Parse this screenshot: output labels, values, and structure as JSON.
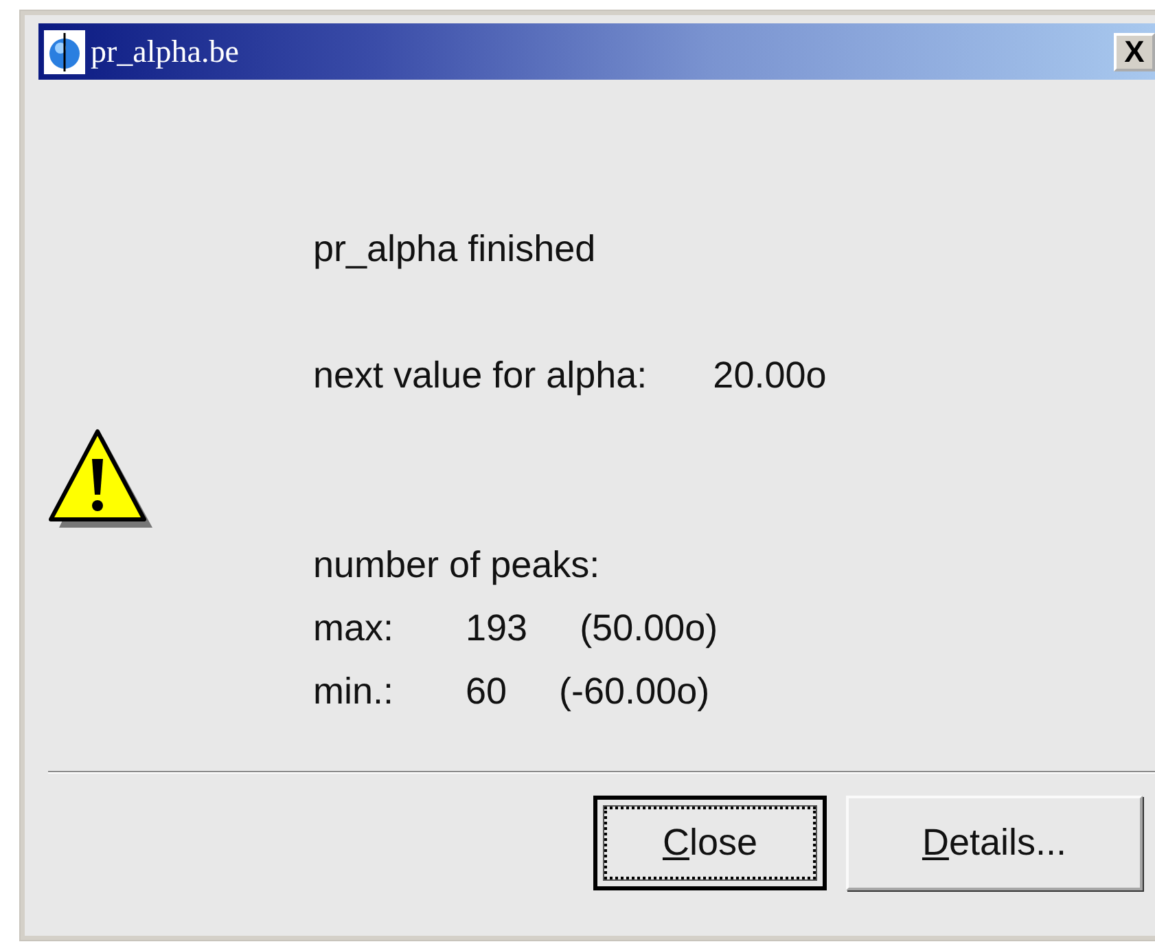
{
  "window": {
    "title": "pr_alpha.be",
    "close_glyph": "X"
  },
  "message": [
    {
      "kind": "text",
      "cells": [
        "pr_alpha finished"
      ]
    },
    {
      "kind": "blank"
    },
    {
      "kind": "pair",
      "cells": [
        "next value for alpha:",
        "20.00o"
      ]
    },
    {
      "kind": "blank"
    },
    {
      "kind": "blank"
    },
    {
      "kind": "text",
      "cells": [
        "number of peaks:"
      ]
    },
    {
      "kind": "triple",
      "cells": [
        "max:",
        "193",
        "(50.00o)"
      ]
    },
    {
      "kind": "triple",
      "cells": [
        "min.:",
        "60",
        "(-60.00o)"
      ]
    }
  ],
  "buttons": [
    {
      "key": "C",
      "rest": "lose",
      "focused": true
    },
    {
      "key": "D",
      "rest": "etails...",
      "focused": false
    }
  ]
}
